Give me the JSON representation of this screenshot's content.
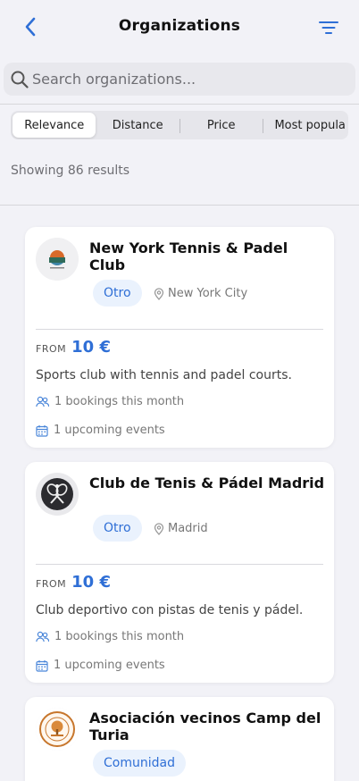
{
  "header": {
    "title": "Organizations",
    "back_icon": "chevron-left-icon",
    "filter_icon": "filter-lines-icon"
  },
  "search": {
    "placeholder": "Search organizations...",
    "value": ""
  },
  "sort": {
    "options": [
      "Relevance",
      "Distance",
      "Price",
      "Most popula"
    ],
    "selected": "Relevance"
  },
  "results": {
    "count_label": "Showing 86 results"
  },
  "organizations": [
    {
      "name": "New York Tennis & Padel Club",
      "tag": "Otro",
      "location": "New York City",
      "price_prefix": "FROM",
      "price": "10 €",
      "description": "Sports club with tennis and padel courts.",
      "bookings": "1 bookings this month",
      "events": "1 upcoming events"
    },
    {
      "name": "Club de Tenis & Pádel Madrid",
      "tag": "Otro",
      "location": "Madrid",
      "price_prefix": "FROM",
      "price": "10 €",
      "description": "Club deportivo con pistas de tenis y pádel.",
      "bookings": "1 bookings this month",
      "events": "1 upcoming events"
    },
    {
      "name": "Asociación vecinos Camp del Turia",
      "tag": "Comunidad"
    }
  ],
  "colors": {
    "accent": "#2f6fd6",
    "tag_bg": "#eaf2fd",
    "background": "#f2f2f7"
  }
}
